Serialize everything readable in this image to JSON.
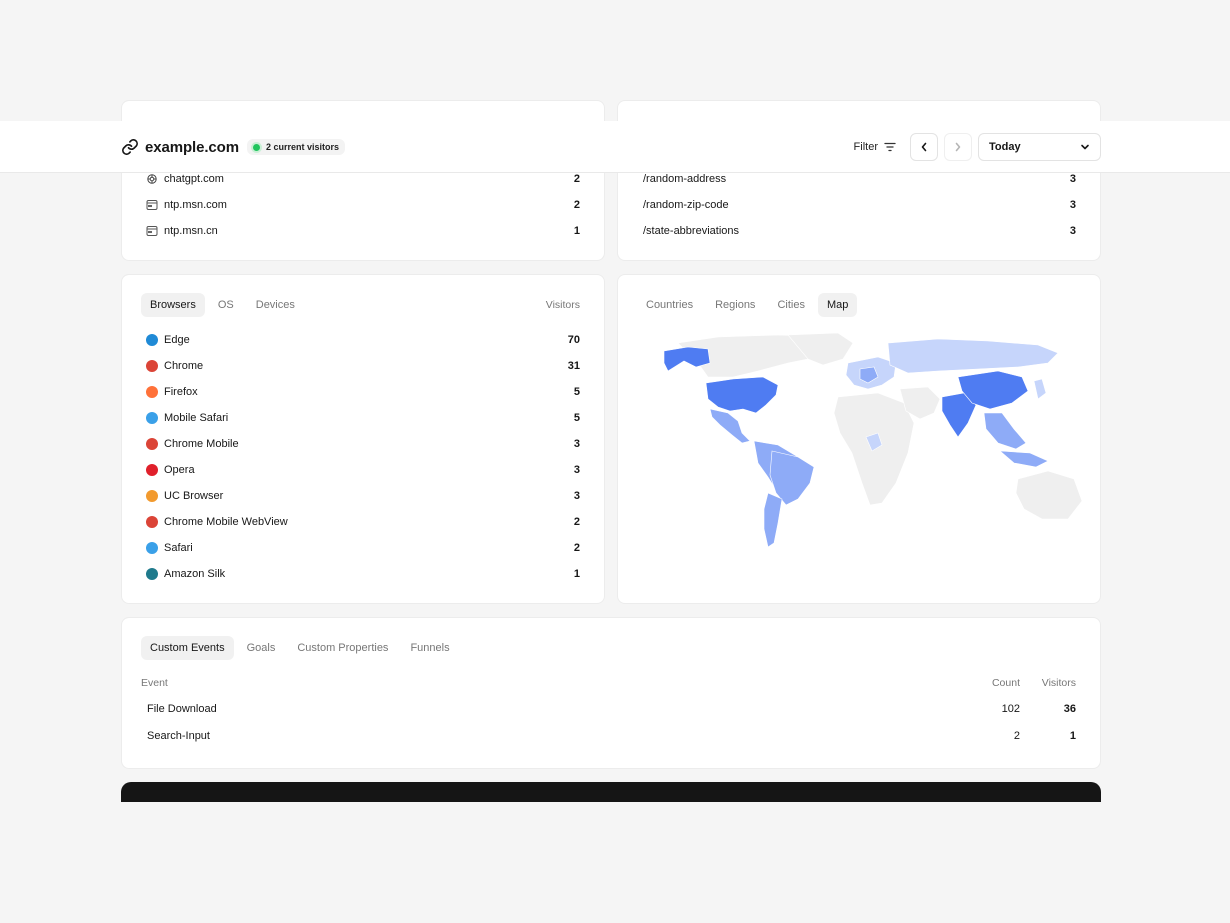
{
  "header": {
    "site": "example.com",
    "current_visitors": "2 current visitors",
    "filter_label": "Filter",
    "date_range": "Today"
  },
  "referrers": {
    "rows": [
      {
        "label": "chatgpt.com",
        "value": "2",
        "icon": "openai-icon"
      },
      {
        "label": "ntp.msn.com",
        "value": "2",
        "icon": "browser-window-icon"
      },
      {
        "label": "ntp.msn.cn",
        "value": "1",
        "icon": "browser-window-icon"
      }
    ]
  },
  "pages": {
    "rows": [
      {
        "label": "/random-address",
        "value": "3"
      },
      {
        "label": "/random-zip-code",
        "value": "3"
      },
      {
        "label": "/state-abbreviations",
        "value": "3"
      }
    ]
  },
  "browsers": {
    "tabs": [
      "Browsers",
      "OS",
      "Devices"
    ],
    "column": "Visitors",
    "rows": [
      {
        "label": "Edge",
        "value": "70",
        "color": "#1f8ad6"
      },
      {
        "label": "Chrome",
        "value": "31",
        "color": "#db4437"
      },
      {
        "label": "Firefox",
        "value": "5",
        "color": "#ff7139"
      },
      {
        "label": "Mobile Safari",
        "value": "5",
        "color": "#3aa0e8"
      },
      {
        "label": "Chrome Mobile",
        "value": "3",
        "color": "#db4437"
      },
      {
        "label": "Opera",
        "value": "3",
        "color": "#e0202b"
      },
      {
        "label": "UC Browser",
        "value": "3",
        "color": "#f29a2e"
      },
      {
        "label": "Chrome Mobile WebView",
        "value": "2",
        "color": "#db4437"
      },
      {
        "label": "Safari",
        "value": "2",
        "color": "#3aa0e8"
      },
      {
        "label": "Amazon Silk",
        "value": "1",
        "color": "#1f7a8c"
      }
    ]
  },
  "geo": {
    "tabs": [
      "Countries",
      "Regions",
      "Cities",
      "Map"
    ],
    "colors": {
      "high": "#4f7cf2",
      "mid": "#8eabf7",
      "low": "#c6d5fb",
      "none": "#efefef"
    }
  },
  "events": {
    "tabs": [
      "Custom Events",
      "Goals",
      "Custom Properties",
      "Funnels"
    ],
    "columns": {
      "event": "Event",
      "count": "Count",
      "visitors": "Visitors"
    },
    "rows": [
      {
        "event": "File Download",
        "count": "102",
        "visitors": "36"
      },
      {
        "event": "Search-Input",
        "count": "2",
        "visitors": "1"
      }
    ]
  }
}
